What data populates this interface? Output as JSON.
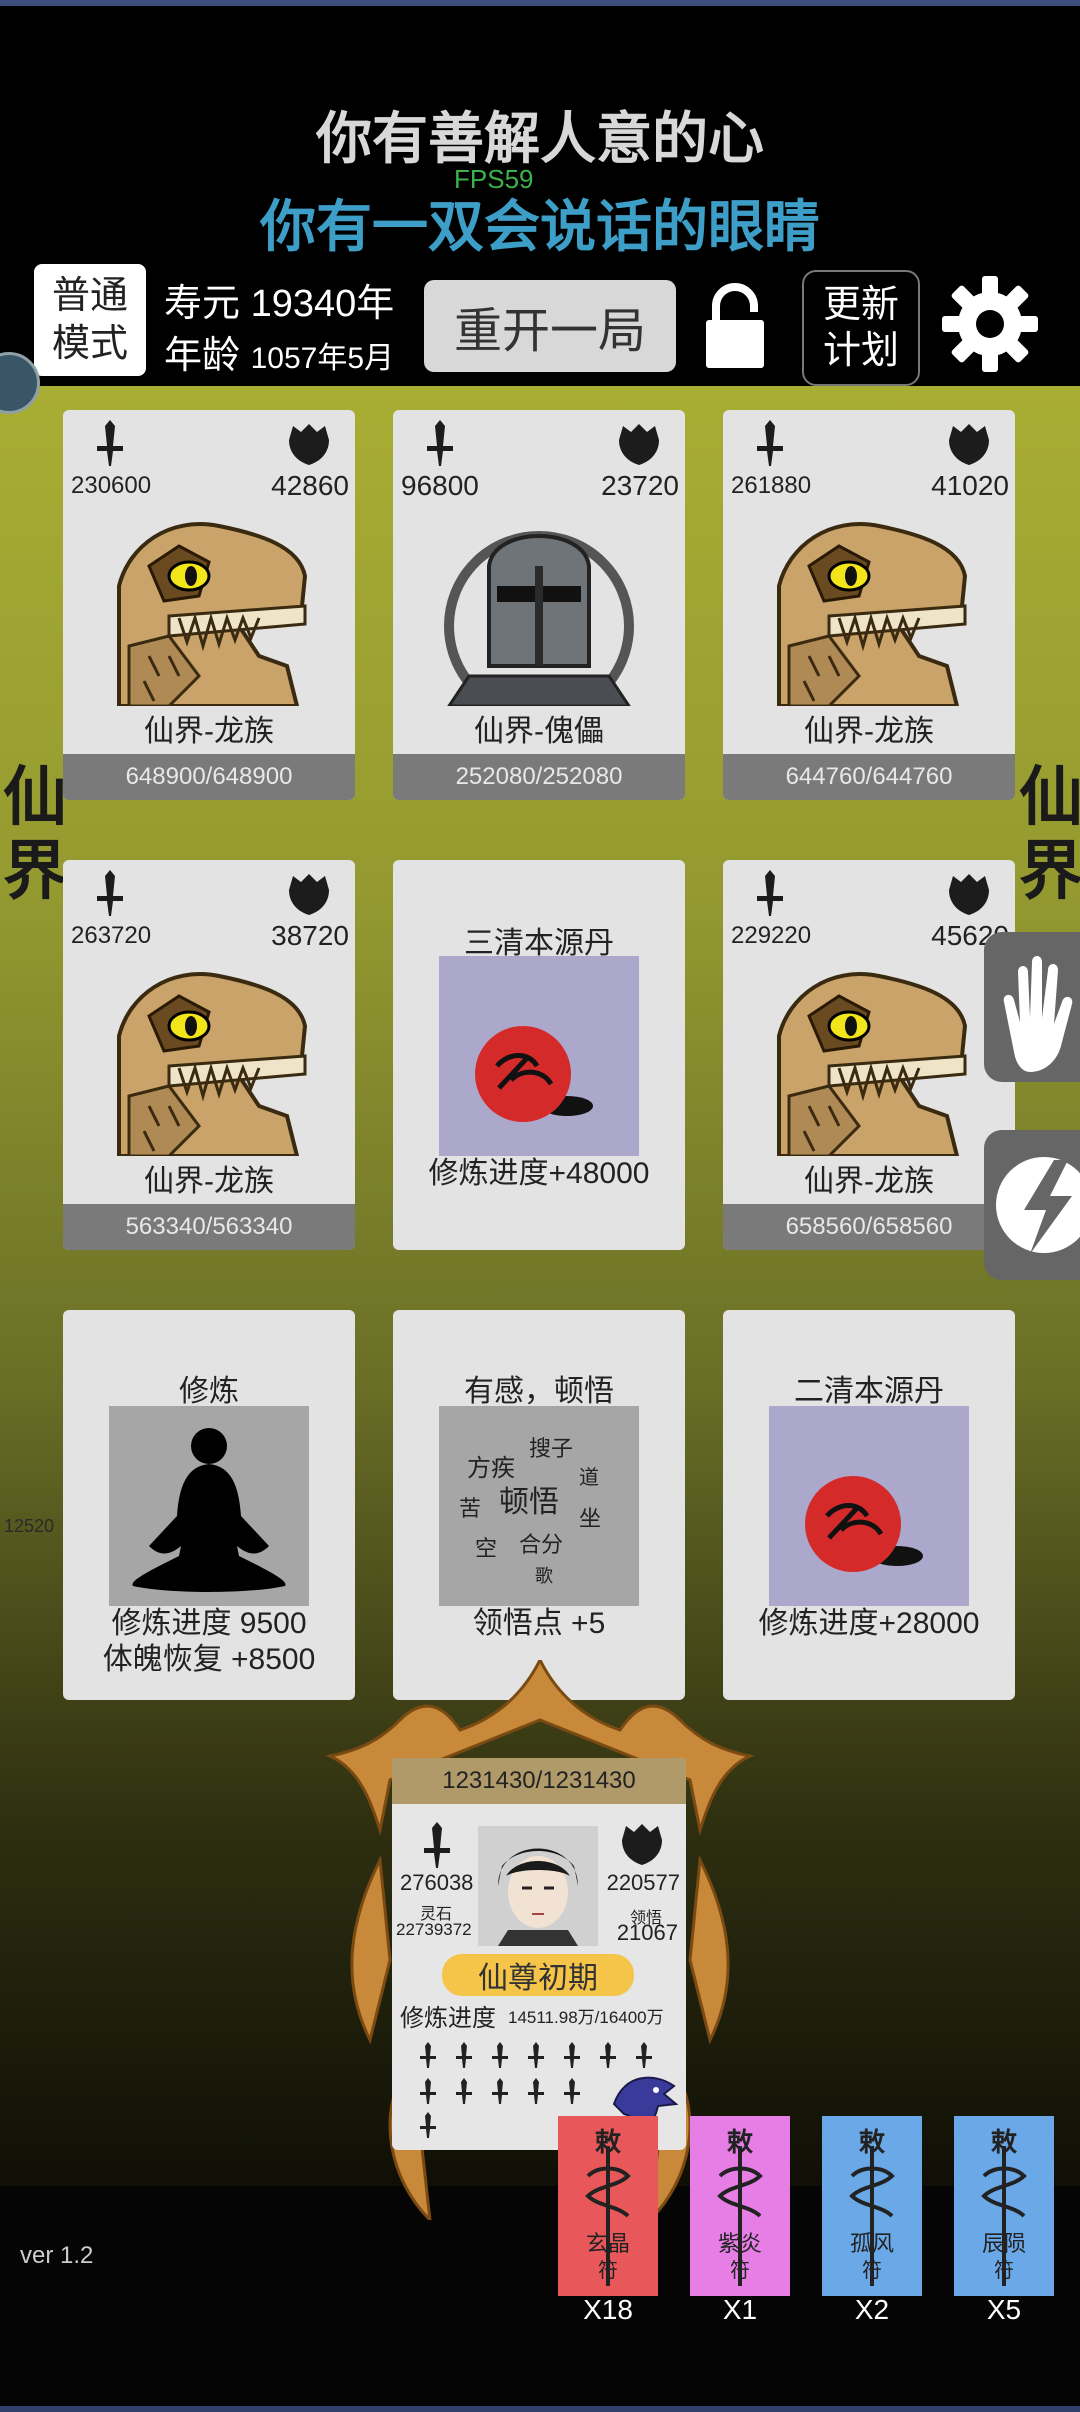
{
  "header": {
    "title_line1": "你有善解人意的心",
    "fps": "FPS59",
    "title_line2": "你有一双会说话的眼睛",
    "mode_line1": "普通",
    "mode_line2": "模式",
    "lifespan_label": "寿元",
    "lifespan_value": "19340年",
    "age_label": "年龄",
    "age_value": "1057年5月",
    "restart_label": "重开一局",
    "plan_line1": "更新",
    "plan_line2": "计划"
  },
  "side": {
    "left_label_1": "仙",
    "left_label_2": "界",
    "right_label_1": "仙",
    "right_label_2": "界",
    "left_number": "12520"
  },
  "cards": [
    {
      "type": "enemy",
      "attack": "230600",
      "defense": "42860",
      "name": "仙界-龙族",
      "hp": "648900/648900",
      "art": "dragon-skull"
    },
    {
      "type": "enemy",
      "attack": "96800",
      "defense": "23720",
      "name": "仙界-傀儡",
      "hp": "252080/252080",
      "art": "knight-helmet"
    },
    {
      "type": "enemy",
      "attack": "261880",
      "defense": "41020",
      "name": "仙界-龙族",
      "hp": "644760/644760",
      "art": "dragon-skull"
    },
    {
      "type": "enemy",
      "attack": "263720",
      "defense": "38720",
      "name": "仙界-龙族",
      "hp": "563340/563340",
      "art": "dragon-skull"
    },
    {
      "type": "item",
      "title": "三清本源丹",
      "effect": "修炼进度+48000",
      "art": "pill"
    },
    {
      "type": "enemy",
      "attack": "229220",
      "defense": "45620",
      "name": "仙界-龙族",
      "hp": "658560/658560",
      "art": "dragon-skull"
    },
    {
      "type": "item",
      "title": "修炼",
      "effect": "修炼进度  9500",
      "effect2": "体魄恢复  +8500",
      "art": "meditation"
    },
    {
      "type": "item",
      "title": "有感，顿悟",
      "effect": "领悟点  +5",
      "art": "enlightenment-text"
    },
    {
      "type": "item",
      "title": "二清本源丹",
      "effect": "修炼进度+28000",
      "art": "pill"
    }
  ],
  "player": {
    "hp": "1231430/1231430",
    "attack": "276038",
    "defense": "220577",
    "spirit_stone_label": "灵石",
    "spirit_stone": "22739372",
    "insight_label": "领悟",
    "insight": "21067",
    "realm": "仙尊初期",
    "progress_label": "修炼进度",
    "progress_value": "14511.98万/16400万"
  },
  "talismans": [
    {
      "name": "玄晶",
      "count": "X18",
      "color": "#e8585a"
    },
    {
      "name": "紫炎",
      "count": "X1",
      "color": "#e77ee6"
    },
    {
      "name": "孤风",
      "count": "X2",
      "color": "#6aa8e8"
    },
    {
      "name": "辰陨",
      "count": "X5",
      "color": "#6aa8e8"
    }
  ],
  "talisman_header": "敕",
  "talisman_footer": "符",
  "version": "ver 1.2"
}
